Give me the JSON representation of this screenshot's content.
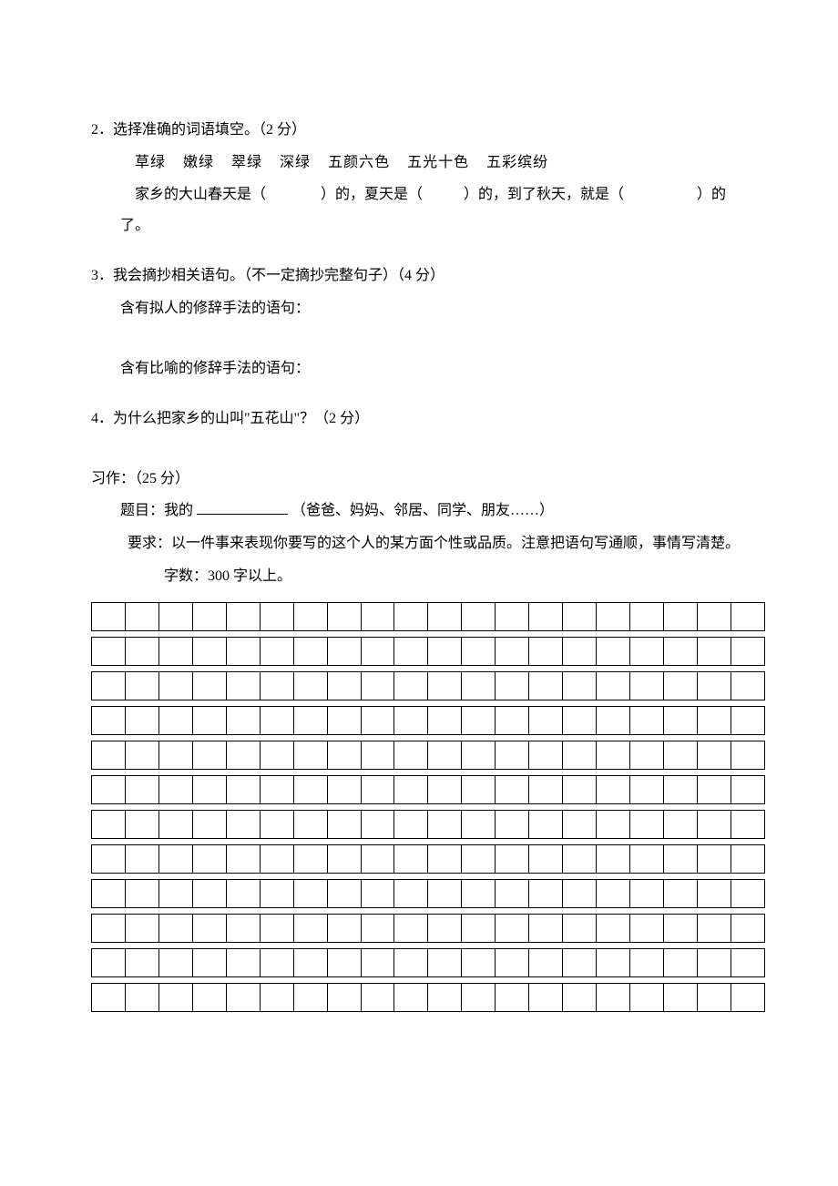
{
  "q2": {
    "number": "2．",
    "title": "选择准确的词语填空。（2 分）",
    "words": [
      "草绿",
      "嫩绿",
      "翠绿",
      "深绿",
      "五颜六色",
      "五光十色",
      "五彩缤纷"
    ],
    "sentence_p1": "家乡的大山春天是（",
    "sentence_p2": "）的，夏天是（",
    "sentence_p3": "）的，到了秋天，就是（",
    "sentence_p4": "）的",
    "sentence_end": "了。"
  },
  "q3": {
    "number": "3．",
    "title": "我会摘抄相关语句。（不一定摘抄完整句子）（4 分）",
    "sub1": "含有拟人的修辞手法的语句：",
    "sub2": "含有比喻的修辞手法的语句："
  },
  "q4": {
    "number": "4．",
    "title": "为什么把家乡的山叫\"五花山\"？（2 分）"
  },
  "writing": {
    "header": "习作：（25 分）",
    "topic_label": "题目：我的 ",
    "topic_hint": " （爸爸、妈妈、邻居、同学、朋友……）",
    "req_label": "要求：",
    "req_text": "以一件事来表现你要写的这个人的某方面个性或品质。注意把语句写通顺，事情写清楚。",
    "wordcount": "字数：300 字以上。"
  },
  "grid": {
    "rows": 12,
    "cols": 20
  }
}
